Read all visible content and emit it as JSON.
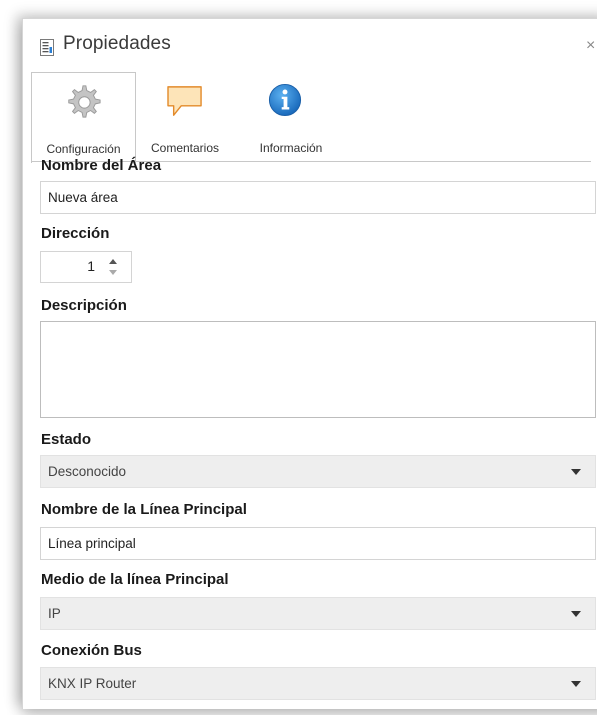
{
  "window": {
    "title": "Propiedades",
    "close_glyph": "×",
    "title_icon": "properties-icon"
  },
  "tabs": [
    {
      "label": "Configuración",
      "icon": "gear-icon",
      "active": true
    },
    {
      "label": "Comentarios",
      "icon": "comment-icon",
      "active": false
    },
    {
      "label": "Información",
      "icon": "info-icon",
      "active": false
    }
  ],
  "fields": {
    "area_name": {
      "label": "Nombre del Área",
      "value": "Nueva área"
    },
    "address": {
      "label": "Dirección",
      "value": "1"
    },
    "description": {
      "label": "Descripción",
      "value": ""
    },
    "state": {
      "label": "Estado",
      "value": "Desconocido"
    },
    "main_line_name": {
      "label": "Nombre de la Línea Principal",
      "value": "Línea principal"
    },
    "main_line_medium": {
      "label": "Medio de la línea Principal",
      "value": "IP"
    },
    "bus_connection": {
      "label": "Conexión Bus",
      "value": "KNX IP Router"
    }
  },
  "colors": {
    "accent_info": "#1e7fd0",
    "comment_fill": "#fde4b8",
    "comment_stroke": "#e38b2b"
  }
}
